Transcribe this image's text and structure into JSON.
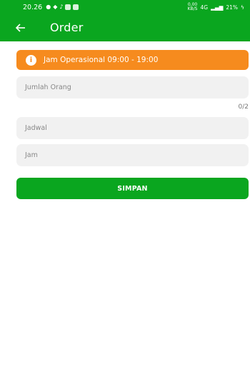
{
  "status_bar": {
    "time": "20.26",
    "net_speed_value": "0,00",
    "net_speed_unit": "KB/S",
    "network_type": "4G",
    "battery": "21%"
  },
  "app_bar": {
    "title": "Order",
    "back_icon": "arrow-left-icon"
  },
  "banner": {
    "icon": "info-icon",
    "icon_glyph": "i",
    "text": "Jam Operasional 09:00 - 19:00",
    "color": "#f68b1e"
  },
  "form": {
    "jumlah_orang_placeholder": "Jumlah Orang",
    "counter": "0/2",
    "jadwal_placeholder": "Jadwal",
    "jam_placeholder": "Jam",
    "submit_label": "SIMPAN"
  },
  "colors": {
    "primary": "#0aa61f",
    "accent": "#f68b1e",
    "field_bg": "#f1f1f1"
  }
}
